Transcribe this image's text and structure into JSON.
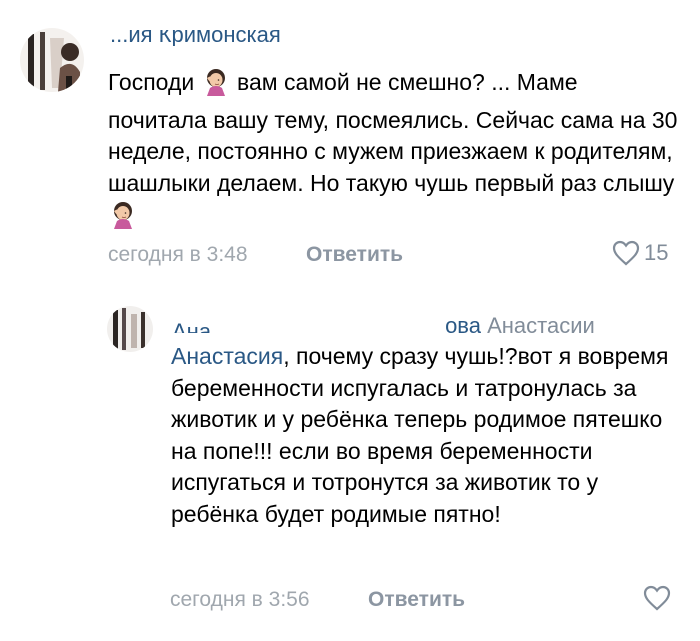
{
  "comment1": {
    "author_visible": "...ия Кримонская",
    "text_parts": {
      "p1": "Господи ",
      "p2": " вам самой не смешно? ...  Маме почитала вашу тему, посмеялись. Сейчас сама на 30 неделе, постоянно с мужем приезжаем к родителям, шашлыки делаем. Но такую чушь первый раз слышу "
    },
    "emoji": "facepalm-woman",
    "date": "сегодня в 3:48",
    "reply_label": "Ответить",
    "likes": "15"
  },
  "comment2": {
    "author_start": "Ана",
    "author_end": "ова",
    "reply_to": "Анастасии",
    "mention": "Анастасия",
    "text": ", почему сразу чушь!?вот я вовремя беременности испугалась и татронулась за животик и у ребёнка теперь родимое пятешко на попе!!! если во время беременности испугаться и тотронутся за животик то у ребёнка будет родимые пятно!",
    "date": "сегодня в 3:56",
    "reply_label": "Ответить"
  },
  "colors": {
    "link": "#2a5885",
    "meta": "#a0a7ae",
    "icon": "#818c99"
  }
}
